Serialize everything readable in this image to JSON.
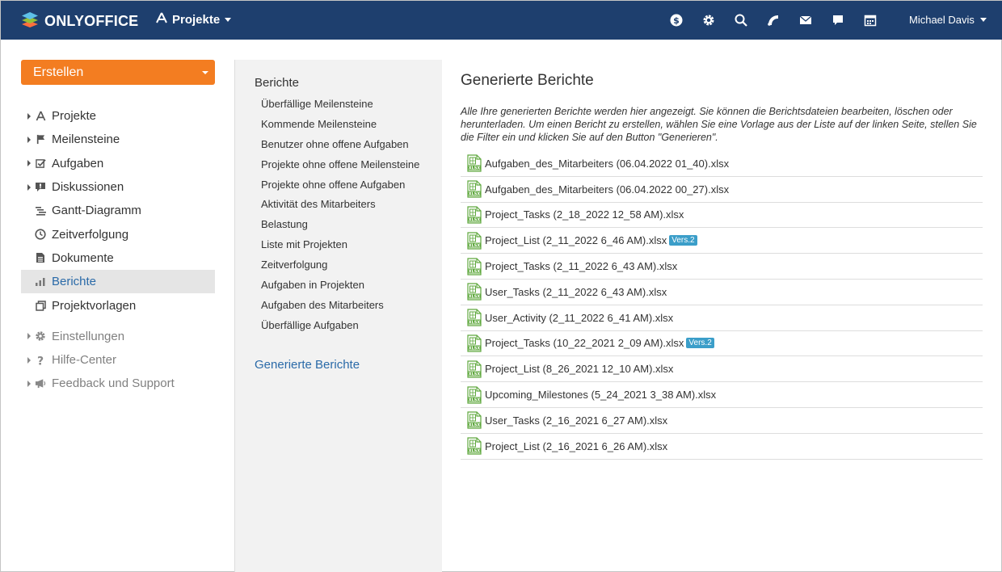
{
  "header": {
    "logo_text": "ONLYOFFICE",
    "module_label": "Projekte",
    "user_name": "Michael Davis",
    "icons": [
      "currency-icon",
      "gear-icon",
      "search-icon",
      "feed-icon",
      "mail-icon",
      "chat-icon",
      "calendar-icon"
    ]
  },
  "sidebar": {
    "create_label": "Erstellen",
    "items": [
      {
        "label": "Projekte",
        "icon": "projects-icon"
      },
      {
        "label": "Meilensteine",
        "icon": "flag-icon"
      },
      {
        "label": "Aufgaben",
        "icon": "task-check-icon"
      },
      {
        "label": "Diskussionen",
        "icon": "discussion-icon"
      },
      {
        "label": "Gantt-Diagramm",
        "icon": "gantt-icon"
      },
      {
        "label": "Zeitverfolgung",
        "icon": "clock-icon"
      },
      {
        "label": "Dokumente",
        "icon": "document-icon"
      },
      {
        "label": "Berichte",
        "icon": "bar-chart-icon"
      },
      {
        "label": "Projektvorlagen",
        "icon": "templates-icon"
      }
    ],
    "bottom_items": [
      {
        "label": "Einstellungen",
        "icon": "gear-icon"
      },
      {
        "label": "Hilfe-Center",
        "icon": "question-icon"
      },
      {
        "label": "Feedback und Support",
        "icon": "megaphone-icon"
      }
    ]
  },
  "reports_menu": {
    "title": "Berichte",
    "items": [
      "Überfällige Meilensteine",
      "Kommende Meilensteine",
      "Benutzer ohne offene Aufgaben",
      "Projekte ohne offene Meilensteine",
      "Projekte ohne offene Aufgaben",
      "Aktivität des Mitarbeiters",
      "Belastung",
      "Liste mit Projekten",
      "Zeitverfolgung",
      "Aufgaben in Projekten",
      "Aufgaben des Mitarbeiters",
      "Überfällige Aufgaben"
    ],
    "generated_link": "Generierte Berichte"
  },
  "main": {
    "title": "Generierte Berichte",
    "description": "Alle Ihre generierten Berichte werden hier angezeigt. Sie können die Berichtsdateien bearbeiten, löschen oder herunterladen. Um einen Bericht zu erstellen, wählen Sie eine Vorlage aus der Liste auf der linken Seite, stellen Sie die Filter ein und klicken Sie auf den Button \"Generieren\".",
    "file_icon_label": "XLSX",
    "files": [
      {
        "name": "Aufgaben_des_Mitarbeiters (06.04.2022 01_40).xlsx",
        "badge": ""
      },
      {
        "name": "Aufgaben_des_Mitarbeiters (06.04.2022 00_27).xlsx",
        "badge": ""
      },
      {
        "name": "Project_Tasks (2_18_2022 12_58 AM).xlsx",
        "badge": ""
      },
      {
        "name": "Project_List (2_11_2022 6_46 AM).xlsx",
        "badge": "Vers.2"
      },
      {
        "name": "Project_Tasks (2_11_2022 6_43 AM).xlsx",
        "badge": ""
      },
      {
        "name": "User_Tasks (2_11_2022 6_43 AM).xlsx",
        "badge": ""
      },
      {
        "name": "User_Activity (2_11_2022 6_41 AM).xlsx",
        "badge": ""
      },
      {
        "name": "Project_Tasks (10_22_2021 2_09 AM).xlsx",
        "badge": "Vers.2"
      },
      {
        "name": "Project_List (8_26_2021 12_10 AM).xlsx",
        "badge": ""
      },
      {
        "name": "Upcoming_Milestones (5_24_2021 3_38 AM).xlsx",
        "badge": ""
      },
      {
        "name": "User_Tasks (2_16_2021 6_27 AM).xlsx",
        "badge": ""
      },
      {
        "name": "Project_List (2_16_2021 6_26 AM).xlsx",
        "badge": ""
      }
    ]
  },
  "colors": {
    "header_bg": "#1e3f6e",
    "accent_orange": "#f37d21",
    "link_blue": "#2a6aa8",
    "badge_blue": "#3b9ec9",
    "xlsx_green": "#5fa83e"
  }
}
